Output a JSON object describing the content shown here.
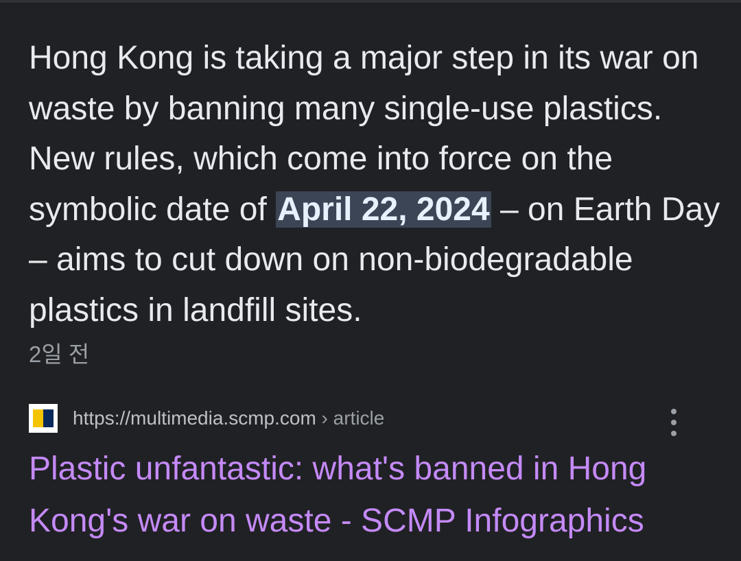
{
  "snippet": {
    "before": "Hong Kong is taking a major step in its war on waste by banning many single-use plastics. New rules, which come into force on the symbolic date of ",
    "highlight": "April 22, 2024",
    "after": " – on Earth Day – aims to cut down on non-biodegradable plastics in landfill sites."
  },
  "age": "2일 전",
  "result": {
    "url": "https://multimedia.scmp.com",
    "breadcrumb": " › article",
    "title": "Plastic unfantastic: what's banned in Hong Kong's war on waste - SCMP Infographics",
    "favicon": "scmp-favicon",
    "more_icon": "more-vert-icon"
  },
  "colors": {
    "background": "#202124",
    "text": "#e8eaed",
    "link_visited": "#c58af9",
    "highlight_bg": "#3c4556",
    "muted": "#9aa0a6"
  }
}
